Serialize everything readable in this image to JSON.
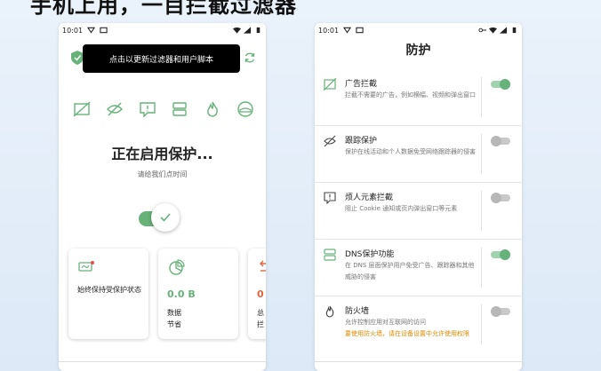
{
  "banner_text": "手机上用，一目拦截过滤器",
  "left": {
    "status": {
      "time": "10:01"
    },
    "tooltip": "点击以更新过滤器和用户脚本",
    "features": [
      "ad-block-icon",
      "tracking-icon",
      "annoyance-icon",
      "dns-icon",
      "firewall-icon",
      "vpn-icon"
    ],
    "status_title": "正在启用保护...",
    "status_subtitle": "请给我们点时间",
    "cards": [
      {
        "label": "始终保持受保护状态"
      },
      {
        "value": "0.0 B",
        "label_line1": "数据",
        "label_line2": "节省"
      },
      {
        "value": "0",
        "label_line1": "总",
        "label_line2": "拦"
      }
    ]
  },
  "right": {
    "status": {
      "time": "10:01"
    },
    "title": "防护",
    "rows": [
      {
        "title": "广告拦截",
        "desc": "拦截不需要的广告，例如横幅、视频和弹出窗口",
        "on": true
      },
      {
        "title": "跟踪保护",
        "desc": "保护在线活动和个人数据免受网络跟踪器的侵害",
        "on": false
      },
      {
        "title": "烦人元素拦截",
        "desc": "阻止 Cookie 通知或页内弹出窗口等元素",
        "on": false
      },
      {
        "title": "DNS保护功能",
        "desc": "在 DNS 层面保护用户免受广告、跟踪器和其他威胁的侵害",
        "on": true
      },
      {
        "title": "防火墙",
        "desc": "允许控制应用对互联网的访问",
        "warn": "要使用防火墙，请在设备设置中允许使用权限",
        "on": false
      }
    ]
  },
  "colors": {
    "accent": "#67b279",
    "warning": "#e08a00"
  }
}
